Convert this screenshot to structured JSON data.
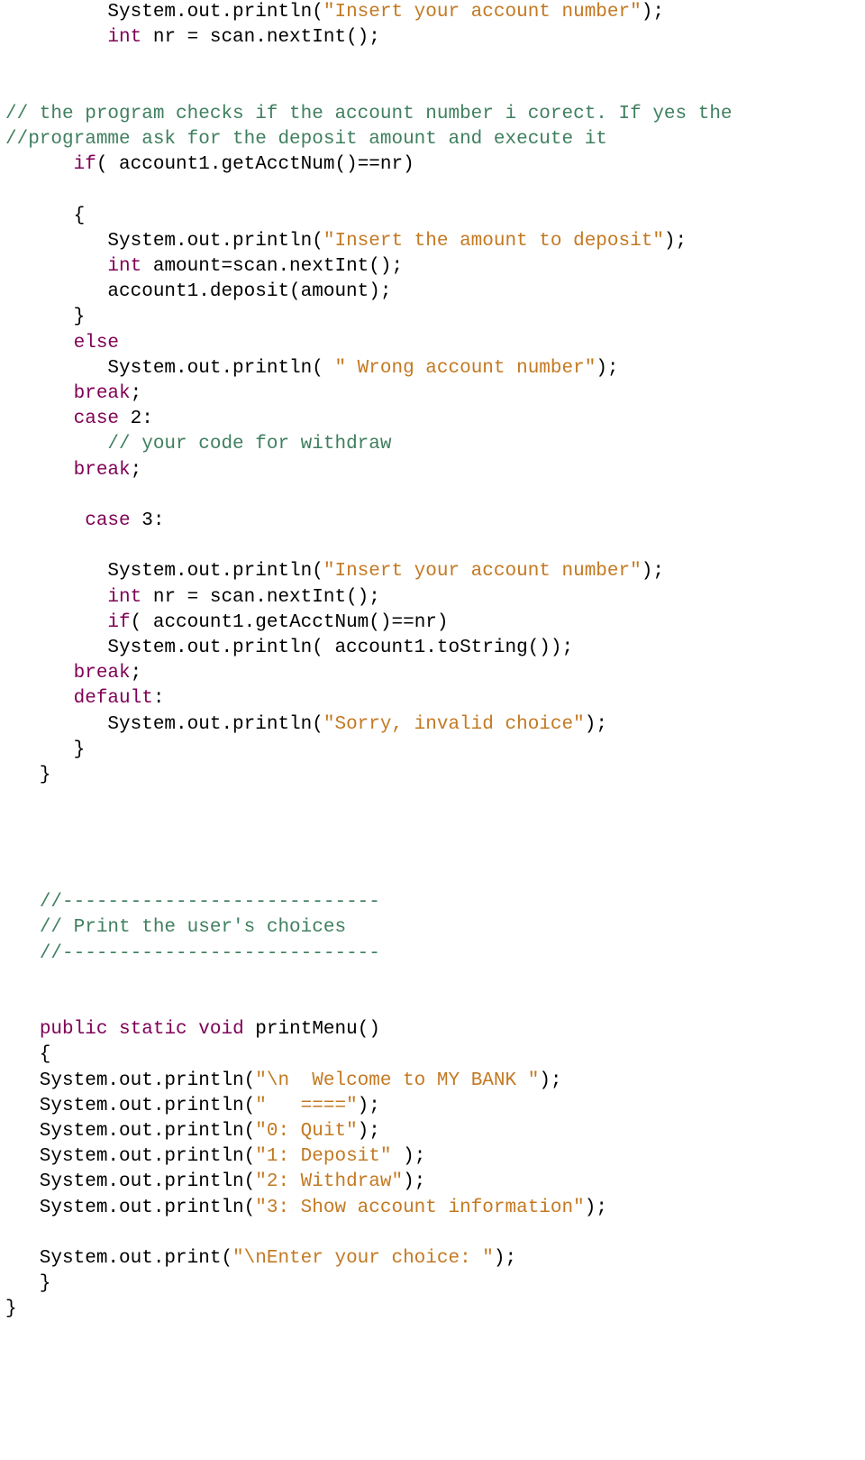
{
  "code": {
    "l01a": "         System.out.println(",
    "l01s": "\"Insert your account number\"",
    "l01b": ");",
    "l02a": "         ",
    "l02k": "int",
    "l02b": " nr = scan.nextInt();",
    "l03": "",
    "l04": "",
    "l05c": "// the program checks if the account number i corect. If yes the",
    "l06c": "//programme ask for the deposit amount and execute it",
    "l07a": "      ",
    "l07k": "if",
    "l07b": "( account1.getAcctNum()==nr)",
    "l08": "",
    "l09": "      {",
    "l10a": "         System.out.println(",
    "l10s": "\"Insert the amount to deposit\"",
    "l10b": ");",
    "l11a": "         ",
    "l11k": "int",
    "l11b": " amount=scan.nextInt();",
    "l12": "         account1.deposit(amount);",
    "l13": "      }",
    "l14a": "      ",
    "l14k": "else",
    "l15a": "         System.out.println( ",
    "l15s": "\" Wrong account number\"",
    "l15b": ");",
    "l16a": "      ",
    "l16k": "break",
    "l16b": ";",
    "l17a": "      ",
    "l17k": "case",
    "l17b": " 2:",
    "l18a": "         ",
    "l18c": "// your code for withdraw",
    "l19a": "      ",
    "l19k": "break",
    "l19b": ";",
    "l20": "",
    "l21a": "       ",
    "l21k": "case",
    "l21b": " 3:",
    "l22": "",
    "l23a": "         System.out.println(",
    "l23s": "\"Insert your account number\"",
    "l23b": ");",
    "l24a": "         ",
    "l24k": "int",
    "l24b": " nr = scan.nextInt();",
    "l25a": "         ",
    "l25k": "if",
    "l25b": "( account1.getAcctNum()==nr)",
    "l26": "         System.out.println( account1.toString());",
    "l27a": "      ",
    "l27k": "break",
    "l27b": ";",
    "l28a": "      ",
    "l28k": "default",
    "l28b": ":",
    "l29a": "         System.out.println(",
    "l29s": "\"Sorry, invalid choice\"",
    "l29b": ");",
    "l30": "      }",
    "l31": "   }",
    "l32": "",
    "l33": "",
    "l34": "",
    "l35": "",
    "l36a": "   ",
    "l36c": "//----------------------------",
    "l37a": "   ",
    "l37c": "// Print the user's choices",
    "l38a": "   ",
    "l38c": "//----------------------------",
    "l39": "",
    "l40": "",
    "l41a": "   ",
    "l41k1": "public",
    "l41s1": " ",
    "l41k2": "static",
    "l41s2": " ",
    "l41k3": "void",
    "l41b": " printMenu()",
    "l42": "   {",
    "l43a": "   System.out.println(",
    "l43s": "\"\\n  Welcome to MY BANK \"",
    "l43b": ");",
    "l44a": "   System.out.println(",
    "l44s": "\"   ====\"",
    "l44b": ");",
    "l45a": "   System.out.println(",
    "l45s": "\"0: Quit\"",
    "l45b": ");",
    "l46a": "   System.out.println(",
    "l46s": "\"1: Deposit\"",
    "l46b": " );",
    "l47a": "   System.out.println(",
    "l47s": "\"2: Withdraw\"",
    "l47b": ");",
    "l48a": "   System.out.println(",
    "l48s": "\"3: Show account information\"",
    "l48b": ");",
    "l49": "",
    "l50a": "   System.out.print(",
    "l50s": "\"\\nEnter your choice: \"",
    "l50b": ");",
    "l51": "   }",
    "l52": "}"
  }
}
